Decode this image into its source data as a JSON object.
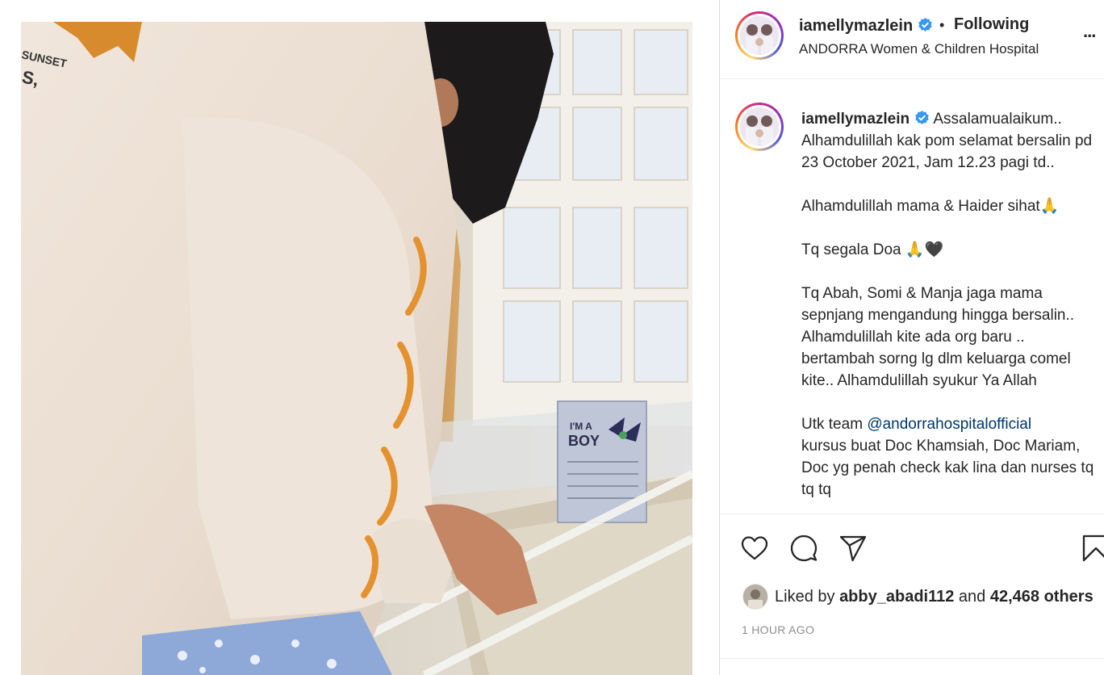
{
  "post": {
    "image_sign_text": "I'M A BOY",
    "sweater_text": "SUNSET"
  },
  "header": {
    "username": "iamellymazlein",
    "dot": "•",
    "follow_status": "Following",
    "location": "ANDORRA Women & Children Hospital",
    "more_label": "..."
  },
  "caption": {
    "username": "iamellymazlein",
    "lines": [
      "Assalamualaikum..",
      "Alhamdulillah kak pom selamat bersalin pd",
      "23 October 2021, Jam 12.23 pagi td..",
      "",
      "Alhamdulillah mama & Haider sihat🙏",
      "",
      "Tq segala Doa 🙏🖤",
      "",
      "Tq Abah, Somi & Manja jaga mama sepnjang mengandung hingga bersalin.. Alhamdulillah kite ada org baru .. bertambah sorng lg dlm keluarga comel kite.. Alhamdulillah syukur Ya Allah",
      ""
    ],
    "team_prefix": "Utk team ",
    "mention": "@andorrahospitalofficial",
    "team_rest": "kursus buat Doc Khamsiah, Doc Mariam, Doc yg penah check kak lina dan nurses tq tq tq"
  },
  "actions": {
    "icons": [
      "heart-icon",
      "comment-icon",
      "share-icon",
      "bookmark-icon"
    ]
  },
  "likes": {
    "prefix": "Liked by ",
    "liker": "abby_abadi112",
    "middle": " and ",
    "others": "42,468 others"
  },
  "timestamp": "1 HOUR AGO",
  "colors": {
    "verified": "#3897f0",
    "link": "#00376b",
    "muted": "#8e8e8e"
  }
}
